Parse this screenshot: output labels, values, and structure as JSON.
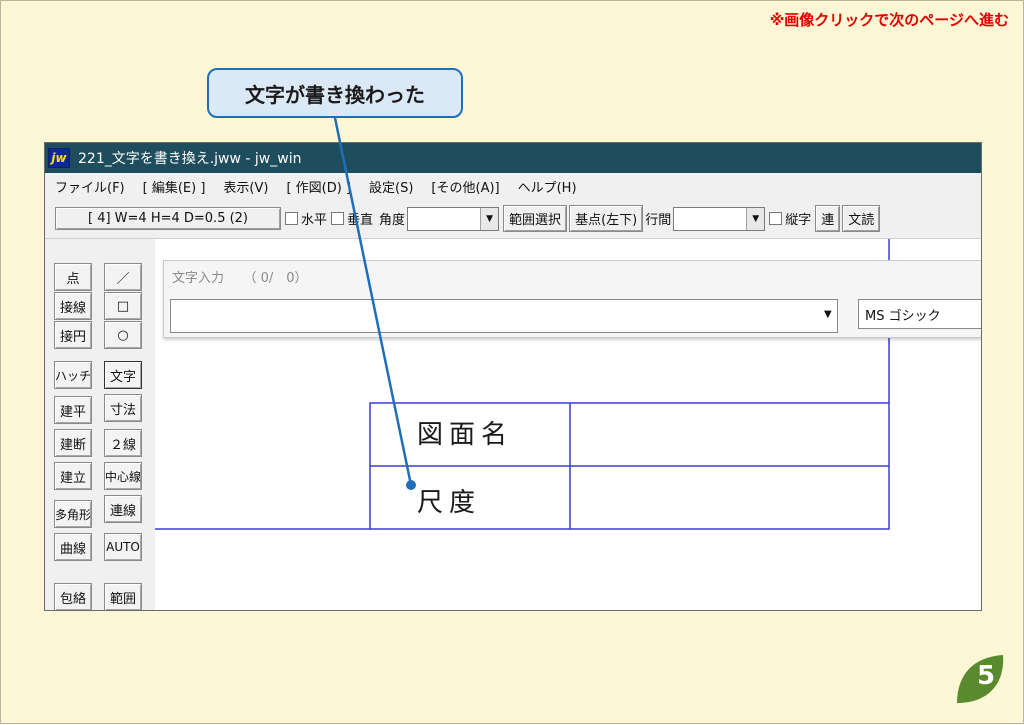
{
  "notice": "※画像クリックで次のページへ進む",
  "callout": "文字が書き換わった",
  "page_number": "5",
  "colors": {
    "accent": "#1f6fb8",
    "notice": "#e00000",
    "titlebar": "#1e4e5e",
    "table_line": "#3a3ad8",
    "badge": "#5a8a2e"
  },
  "window": {
    "icon": "jw",
    "title": "221_文字を書き換え.jww - jw_win",
    "menu": [
      "ファイル(F)",
      "[ 編集(E) ]",
      "表示(V)",
      "[ 作図(D) ]",
      "設定(S)",
      "[その他(A)]",
      "ヘルプ(H)"
    ],
    "toolbar": {
      "layer_btn": "[ 4]  W=4  H=4  D=0.5 (2)",
      "horizontal": "水平",
      "vertical": "垂直",
      "angle": "角度",
      "range_select": "範囲選択",
      "base_point": "基点(左下)",
      "line_spacing": "行間",
      "vertical_text": "縦字",
      "continuous": "連",
      "read_text": "文読"
    }
  },
  "tools_left": [
    "点",
    "接線",
    "接円",
    "ハッチ",
    "建平",
    "建断",
    "建立",
    "多角形",
    "曲線",
    "包絡"
  ],
  "tools_right": [
    "／",
    "□",
    "○",
    "文字",
    "寸法",
    "２線",
    "中心線",
    "連線",
    "AUTO",
    "範囲"
  ],
  "text_input": {
    "caption": "文字入力　　（ 0/　0）",
    "value": "",
    "font": "MS ゴシック"
  },
  "drawing": {
    "row1": "図面名",
    "row2": "尺度"
  }
}
